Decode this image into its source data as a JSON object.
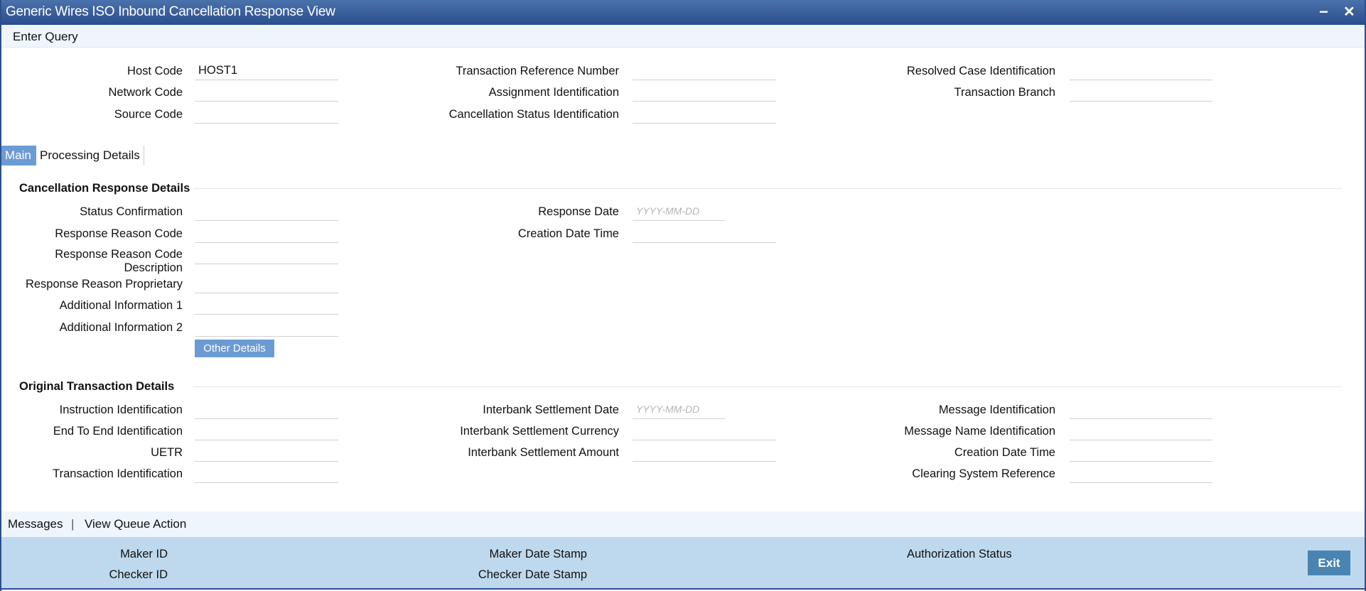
{
  "window": {
    "title": "Generic Wires ISO Inbound Cancellation Response View",
    "minimize": "−",
    "close": "✕"
  },
  "toolbar": {
    "enter_query": "Enter Query"
  },
  "header": {
    "host_code": {
      "label": "Host Code",
      "value": "HOST1"
    },
    "network_code": {
      "label": "Network Code",
      "value": ""
    },
    "source_code": {
      "label": "Source Code",
      "value": ""
    },
    "txn_ref": {
      "label": "Transaction Reference Number",
      "value": ""
    },
    "assignment_id": {
      "label": "Assignment Identification",
      "value": ""
    },
    "cancel_status_id": {
      "label": "Cancellation Status Identification",
      "value": ""
    },
    "resolved_case_id": {
      "label": "Resolved Case Identification",
      "value": ""
    },
    "txn_branch": {
      "label": "Transaction Branch",
      "value": ""
    }
  },
  "tabs": [
    {
      "label": "Main",
      "active": true
    },
    {
      "label": "Processing Details",
      "active": false
    }
  ],
  "cancellation": {
    "title": "Cancellation Response Details",
    "status_confirmation": "Status Confirmation",
    "reason_code": "Response Reason Code",
    "reason_code_desc_1": "Response Reason Code",
    "reason_code_desc_2": "Description",
    "reason_proprietary": "Response Reason Proprietary",
    "add_info_1": "Additional Information 1",
    "add_info_2": "Additional Information 2",
    "response_date": "Response Date",
    "creation_date_time": "Creation Date Time",
    "date_placeholder": "YYYY-MM-DD",
    "other_details": "Other Details"
  },
  "original": {
    "title": "Original Transaction Details",
    "instruction_id": "Instruction Identification",
    "end_to_end_id": "End To End Identification",
    "uetr": "UETR",
    "transaction_id": "Transaction Identification",
    "settlement_date": "Interbank Settlement Date",
    "settlement_currency": "Interbank Settlement Currency",
    "settlement_amount": "Interbank Settlement Amount",
    "message_id": "Message Identification",
    "message_name_id": "Message Name Identification",
    "creation_date_time": "Creation Date Time",
    "clearing_ref": "Clearing System Reference",
    "date_placeholder": "YYYY-MM-DD"
  },
  "links": {
    "messages": "Messages",
    "separator": "|",
    "view_queue": "View Queue Action"
  },
  "footer": {
    "maker_id": "Maker ID",
    "checker_id": "Checker ID",
    "maker_date": "Maker Date Stamp",
    "checker_date": "Checker Date Stamp",
    "auth_status": "Authorization Status",
    "exit": "Exit"
  }
}
